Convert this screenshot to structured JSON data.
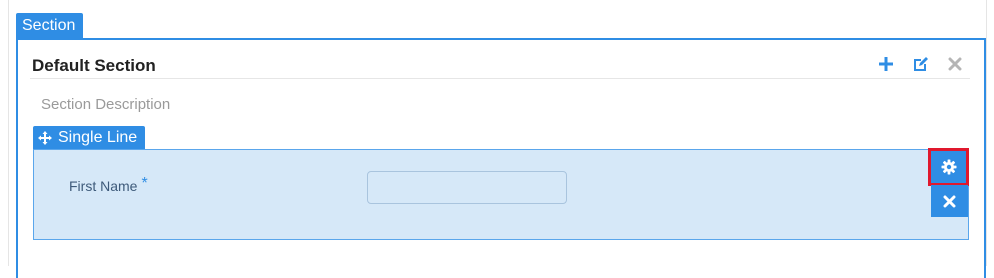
{
  "section_tab": {
    "label": "Section"
  },
  "section": {
    "title": "Default Section",
    "description": "Section Description",
    "actions": {
      "add_icon": "plus-icon",
      "edit_icon": "edit-icon",
      "close_icon": "close-icon"
    }
  },
  "field": {
    "type_label": "Single Line",
    "move_icon": "move-arrows-icon",
    "label": "First Name",
    "required_mark": "*",
    "value": "",
    "settings_icon": "gear-icon",
    "delete_icon": "close-icon"
  },
  "colors": {
    "accent": "#2f8de4",
    "panel_bg": "#d6e8f8",
    "highlight_border": "#e0182d"
  }
}
